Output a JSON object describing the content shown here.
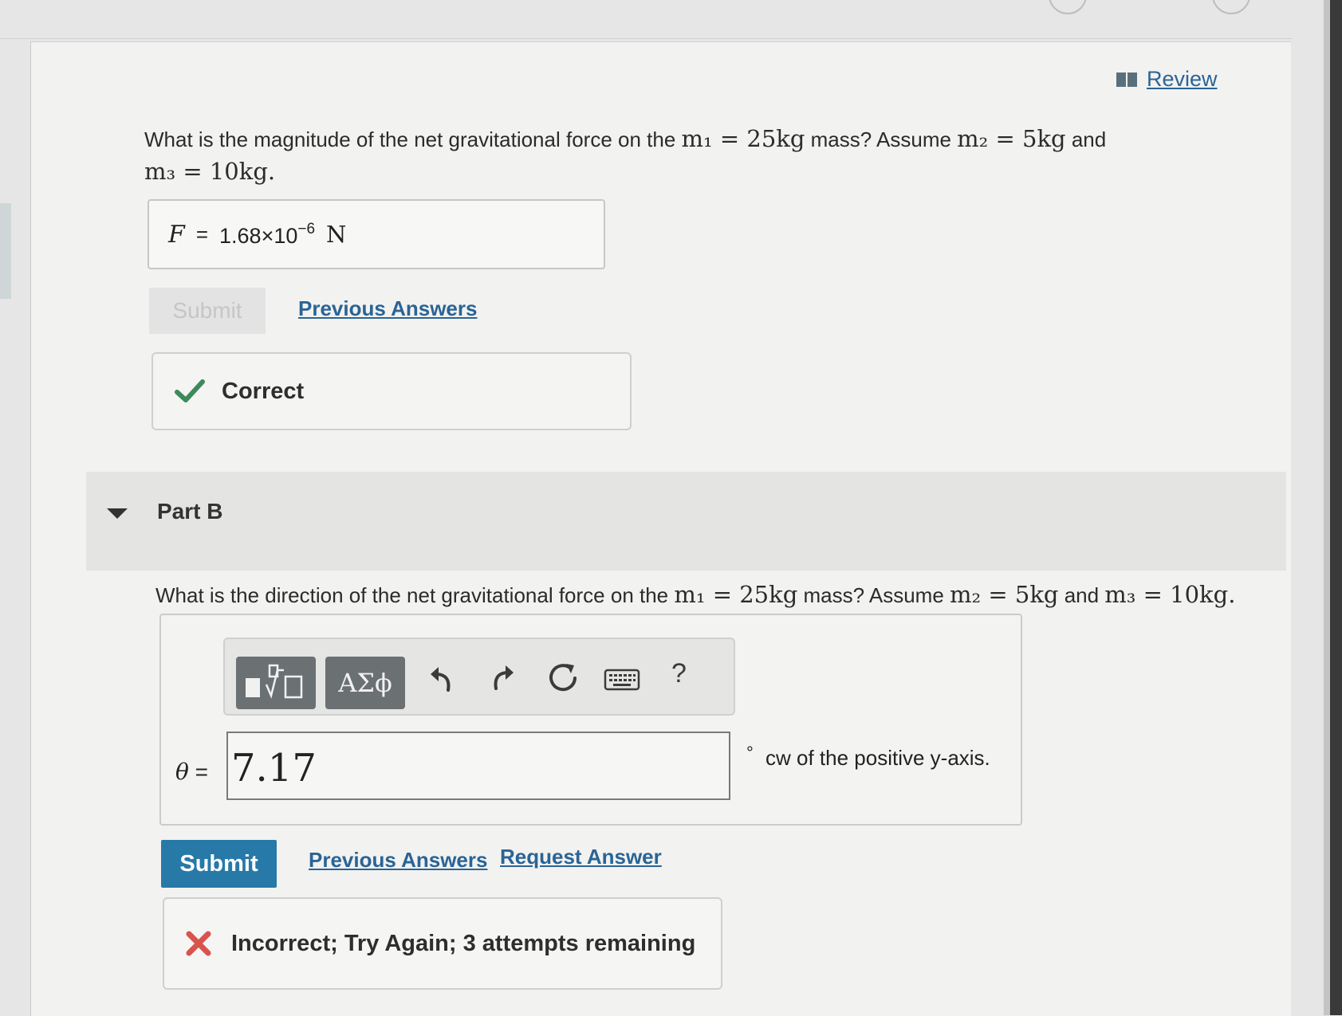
{
  "review": {
    "label": "Review"
  },
  "part_a": {
    "question_start": "What is the magnitude of the net gravitational force on the ",
    "m1": "m₁ = 25kg",
    "question_mid": " mass? Assume ",
    "m2": "m₂ = 5kg",
    "and_word": " and",
    "m3": "m₃ = 10kg.",
    "answer_lhs": "F",
    "answer_eq": "=",
    "answer_mantissa": "1.68×10",
    "answer_exponent": "−6",
    "answer_unit": "N",
    "submit_label": "Submit",
    "previous_answers_label": "Previous Answers",
    "feedback": "Correct"
  },
  "part_b": {
    "title": "Part B",
    "question_start": "What is the direction of the net gravitational force on the ",
    "m1": "m₁ = 25kg",
    "question_mid": " mass? Assume ",
    "m2": "m₂ = 5kg",
    "and_word": " and ",
    "m3": "m₃ = 10kg.",
    "toolbar": {
      "greek_label": "ΑΣϕ",
      "help_label": "?"
    },
    "theta_symbol": "θ",
    "theta_eq": "=",
    "input_value": "7.17",
    "degree_symbol": "°",
    "unit_text": "cw of the positive y-axis.",
    "submit_label": "Submit",
    "previous_answers_label": "Previous Answers",
    "request_answer_label": "Request Answer",
    "feedback": "Incorrect; Try Again; 3 attempts remaining"
  },
  "colors": {
    "link": "#2a6496",
    "submit_active": "#2779a8",
    "correct_check": "#3c8a5a",
    "incorrect_x": "#d9534f"
  }
}
